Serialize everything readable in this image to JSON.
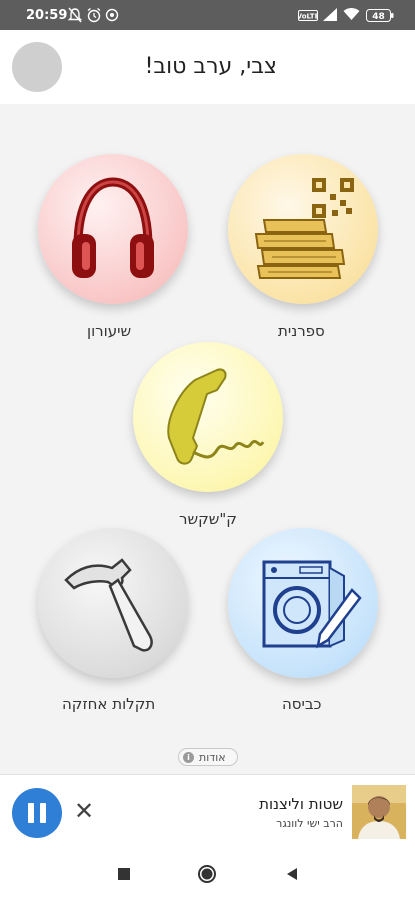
{
  "status_bar": {
    "time": "20:59",
    "battery": "48",
    "left_icons": [
      "bell-off-icon",
      "alarm-icon",
      "location-icon"
    ],
    "right_icons": [
      "volte-icon",
      "signal-icon",
      "wifi-icon",
      "battery-icon"
    ]
  },
  "header": {
    "greeting": "צבי, ערב טוב!"
  },
  "tiles": {
    "library": {
      "label": "ספרנית",
      "icon": "books-qr-icon"
    },
    "lessons": {
      "label": "שיעורון",
      "icon": "headphones-icon"
    },
    "contact": {
      "label": "ק\"שקשר",
      "icon": "phone-icon"
    },
    "laundry": {
      "label": "כביסה",
      "icon": "washing-machine-icon"
    },
    "maintenance": {
      "label": "תקלות אחזקה",
      "icon": "hammer-icon"
    }
  },
  "about": {
    "label": "אודות",
    "icon": "info-icon"
  },
  "player": {
    "title": "שטות וליצנות",
    "artist": "הרב ישי לוונגר",
    "state_icon": "pause-icon",
    "close_icon": "close-icon"
  },
  "colors": {
    "status_bar": "#5d5d5d",
    "accent": "#2f7fd6",
    "library_tile": "#fbe4a8",
    "lessons_tile": "#f9c7c7",
    "contact_tile": "#fdf7b4",
    "laundry_tile": "#c6e3fb",
    "maintenance_tile": "#dcdcdc"
  },
  "nav": [
    "recents-square-icon",
    "home-circle-icon",
    "back-triangle-icon"
  ]
}
